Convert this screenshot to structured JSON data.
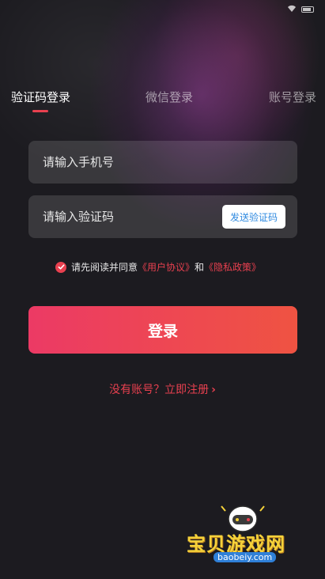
{
  "status_bar": {
    "time": "",
    "signal": "",
    "wifi": "wifi-icon",
    "battery": "battery-icon"
  },
  "tabs": [
    {
      "label": "验证码登录",
      "active": true
    },
    {
      "label": "微信登录",
      "active": false
    },
    {
      "label": "账号登录",
      "active": false
    }
  ],
  "phone_field": {
    "placeholder": "请输入手机号",
    "value": ""
  },
  "code_field": {
    "placeholder": "请输入验证码",
    "value": "",
    "send_code_label": "发送验证码"
  },
  "agreement": {
    "checked": true,
    "prefix": "请先阅读并同意",
    "user_agreement": "《用户协议》",
    "and": "和",
    "privacy_policy": "《隐私政策》"
  },
  "login_button": {
    "label": "登录"
  },
  "register_link": {
    "label": "没有账号？立即注册"
  },
  "watermark": {
    "title": "宝贝游戏网",
    "url": "baobeiy.com"
  },
  "colors": {
    "accent": "#e8404f",
    "link_blue": "#2f8ae0",
    "background": "#1c1b20"
  }
}
